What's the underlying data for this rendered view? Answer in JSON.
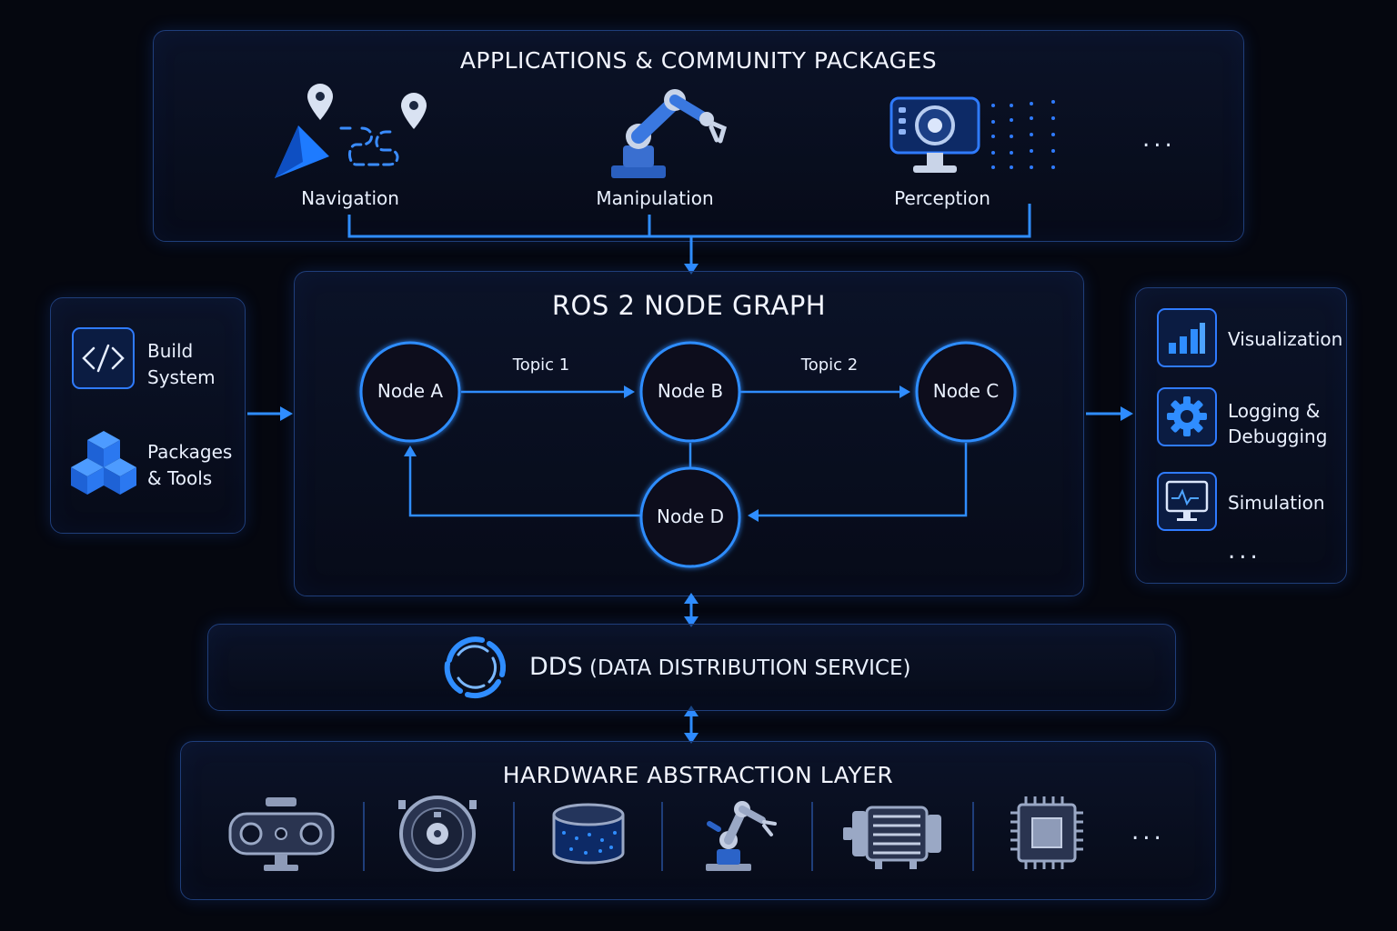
{
  "applications": {
    "title": "APPLICATIONS & COMMUNITY PACKAGES",
    "items": [
      {
        "label": "Navigation",
        "icon": "navigation-icon"
      },
      {
        "label": "Manipulation",
        "icon": "robot-arm-icon"
      },
      {
        "label": "Perception",
        "icon": "camera-icon"
      }
    ],
    "more": "..."
  },
  "node_graph": {
    "title": "ROS 2 NODE GRAPH",
    "nodes": [
      "Node A",
      "Node B",
      "Node C",
      "Node D"
    ],
    "topics": [
      "Topic 1",
      "Topic 2"
    ]
  },
  "dev_tools": {
    "items": [
      {
        "label_line1": "Build",
        "label_line2": "System",
        "icon": "code-icon"
      },
      {
        "label_line1": "Packages",
        "label_line2": "& Tools",
        "icon": "cubes-icon"
      }
    ]
  },
  "tools": {
    "items": [
      {
        "label_line1": "Visualization",
        "label_line2": "",
        "icon": "bar-chart-icon"
      },
      {
        "label_line1": "Logging &",
        "label_line2": "Debugging",
        "icon": "gear-icon"
      },
      {
        "label_line1": "Simulation",
        "label_line2": "",
        "icon": "monitor-icon"
      }
    ],
    "more": "..."
  },
  "dds": {
    "title_bold": "DDS",
    "title_rest": " (DATA DISTRIBUTION SERVICE)",
    "icon": "dds-ring-icon"
  },
  "hardware": {
    "title": "HARDWARE ABSTRACTION LAYER",
    "icons": [
      "stereo-camera-icon",
      "lidar-icon",
      "sensor-drum-icon",
      "robot-arm-icon",
      "motor-icon",
      "chip-icon"
    ],
    "more": "..."
  },
  "colors": {
    "accent": "#2f8dff",
    "panel_border": "#1f3e7a",
    "background": "#05070f"
  }
}
